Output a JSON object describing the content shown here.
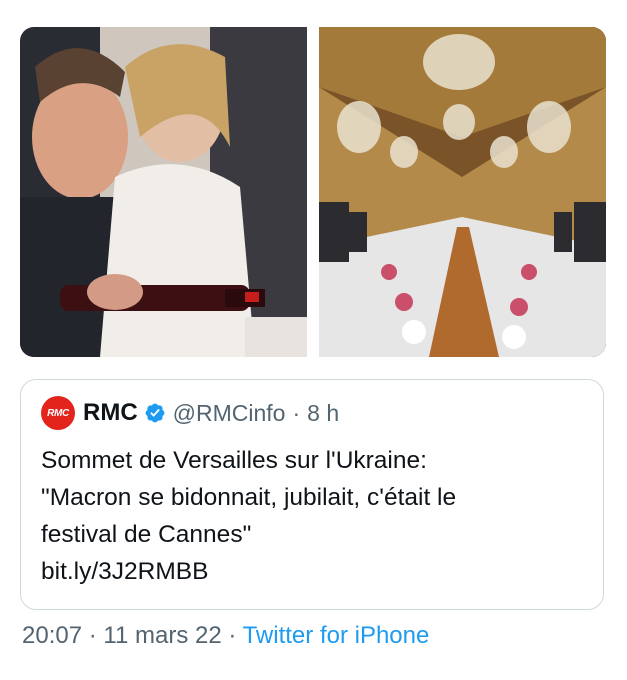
{
  "media": {
    "left_photo_alt": "",
    "right_photo_alt": ""
  },
  "quote": {
    "logo_text": "RMC",
    "author_name": "RMC",
    "handle": "@RMCinfo",
    "separator": "·",
    "time_ago": "8 h",
    "lines": [
      "Sommet de Versailles sur l'Ukraine:",
      "\"Macron se bidonnait, jubilait, c'était le",
      "festival de Cannes\"",
      "bit.ly/3J2RMBB"
    ]
  },
  "footer": {
    "time": "20:07",
    "separator": "·",
    "date": "11 mars 22",
    "separator2": "·",
    "source": "Twitter for iPhone"
  },
  "colors": {
    "link": "#1d9bf0",
    "muted": "#536471",
    "border": "#cfd9de",
    "rmc_red": "#e2241c",
    "verified": "#1d9bf0"
  },
  "icons": [
    "verified-badge-icon"
  ]
}
